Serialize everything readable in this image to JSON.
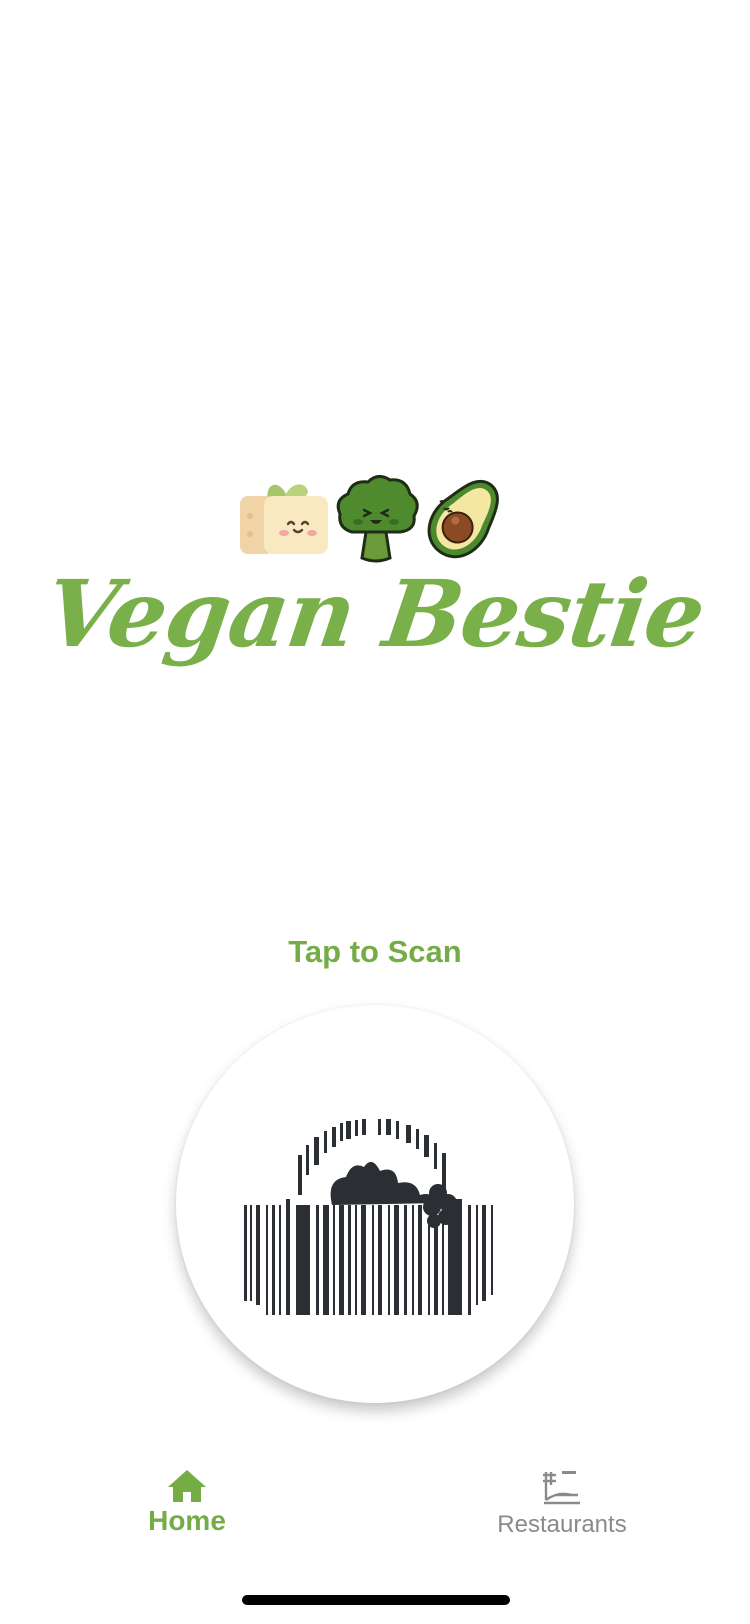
{
  "app": {
    "title": "Vegan Bestie",
    "brand_color": "#79b04a"
  },
  "mascots": [
    "tofu-icon",
    "broccoli-icon",
    "avocado-icon"
  ],
  "scan": {
    "label": "Tap to Scan",
    "icon": "barcode-basket-icon"
  },
  "tabbar": {
    "home_label": "Home",
    "restaurants_label": "Restaurants",
    "active": "Home",
    "active_color": "#74ad46",
    "inactive_color": "#8a8a8a"
  }
}
